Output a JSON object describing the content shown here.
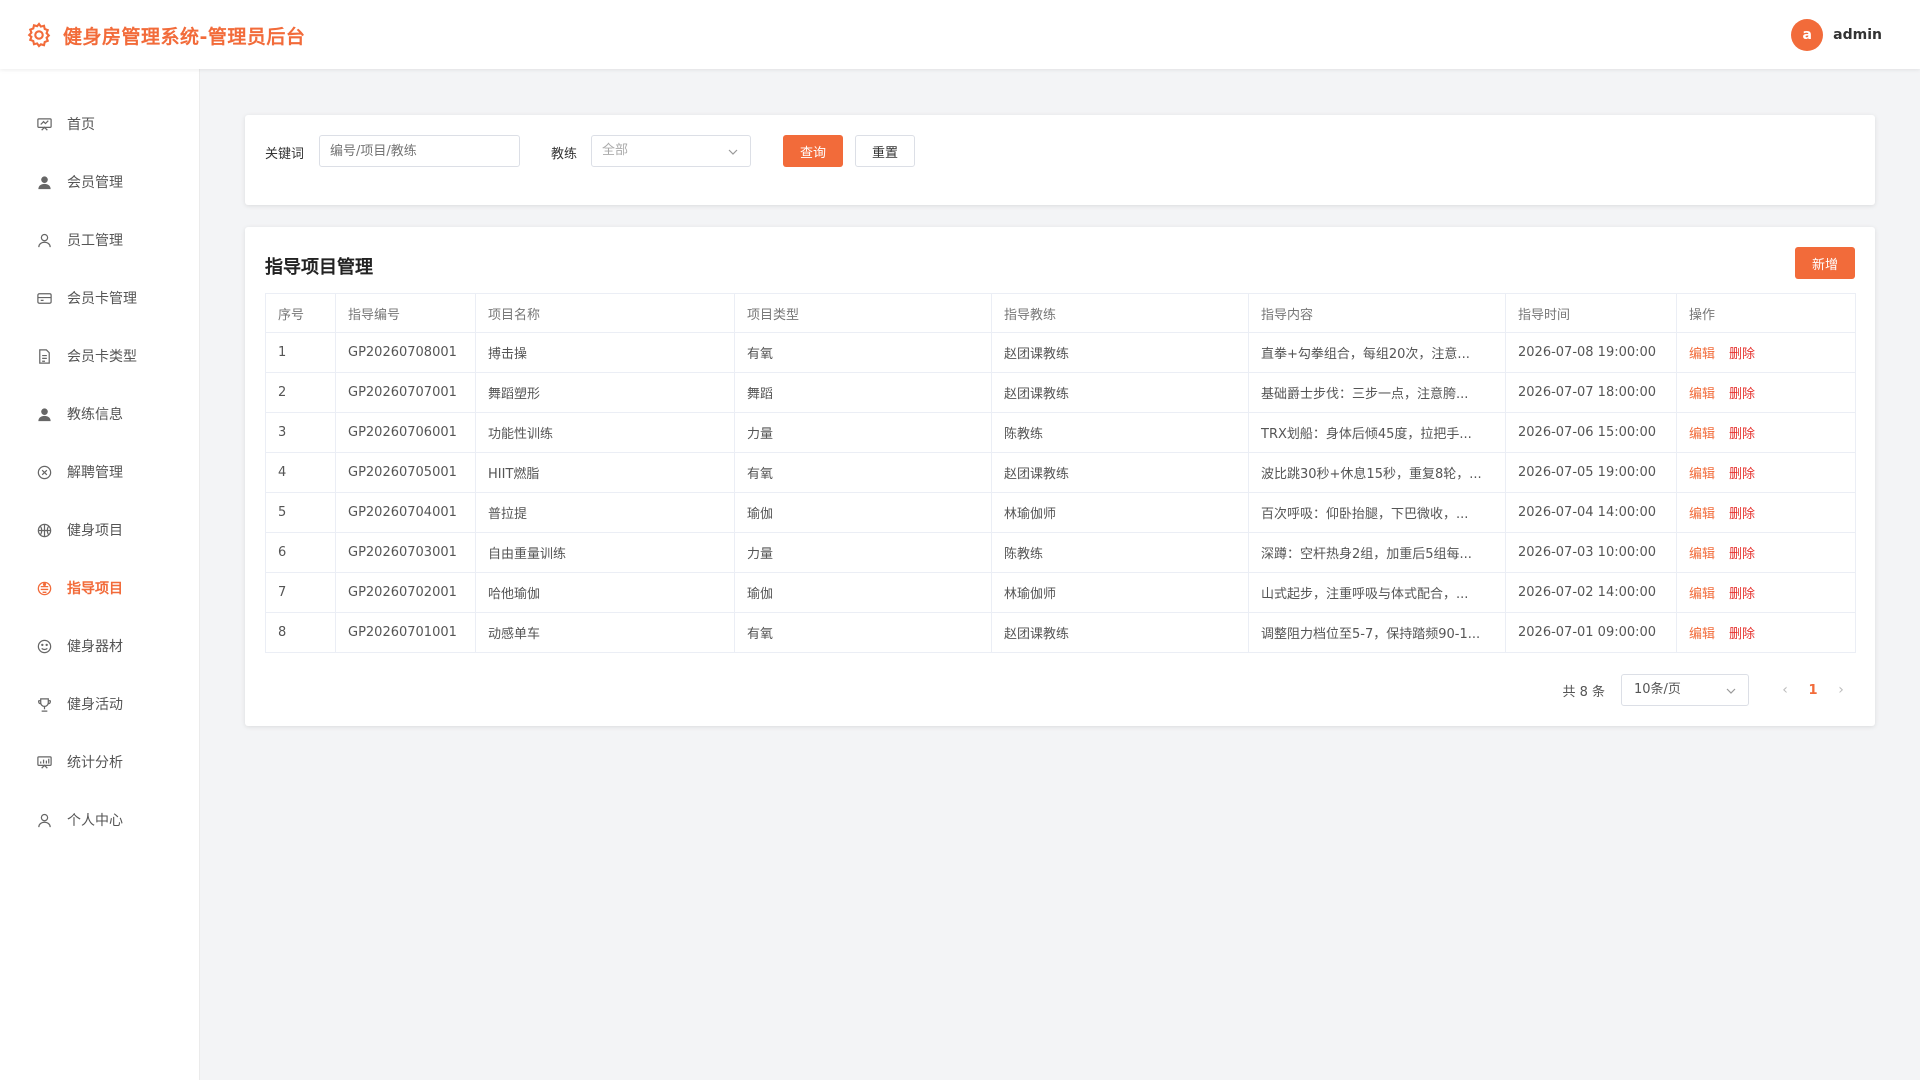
{
  "header": {
    "app_title": "健身房管理系统-管理员后台",
    "avatar_letter": "a",
    "username": "admin"
  },
  "colors": {
    "accent": "#f26b3a",
    "danger": "#e6322e"
  },
  "sidebar": {
    "items": [
      {
        "label": "首页",
        "icon": "dashboard-icon"
      },
      {
        "label": "会员管理",
        "icon": "user-solid-icon"
      },
      {
        "label": "员工管理",
        "icon": "user-outline-icon"
      },
      {
        "label": "会员卡管理",
        "icon": "card-icon"
      },
      {
        "label": "会员卡类型",
        "icon": "document-icon"
      },
      {
        "label": "教练信息",
        "icon": "user-solid-icon"
      },
      {
        "label": "解聘管理",
        "icon": "circle-close-icon"
      },
      {
        "label": "健身项目",
        "icon": "basketball-icon"
      },
      {
        "label": "指导项目",
        "icon": "guide-icon",
        "active": true
      },
      {
        "label": "健身器材",
        "icon": "smile-icon"
      },
      {
        "label": "健身活动",
        "icon": "trophy-icon"
      },
      {
        "label": "统计分析",
        "icon": "chart-icon"
      },
      {
        "label": "个人中心",
        "icon": "user-outline-icon"
      }
    ]
  },
  "filter": {
    "keyword_label": "关键词",
    "keyword_placeholder": "编号/项目/教练",
    "coach_label": "教练",
    "coach_value": "全部",
    "search_label": "查询",
    "reset_label": "重置"
  },
  "table": {
    "title": "指导项目管理",
    "add_label": "新增",
    "columns": [
      "序号",
      "指导编号",
      "项目名称",
      "项目类型",
      "指导教练",
      "指导内容",
      "指导时间",
      "操作"
    ],
    "edit_label": "编辑",
    "delete_label": "删除",
    "rows": [
      [
        "1",
        "GP20260708001",
        "搏击操",
        "有氧",
        "赵团课教练",
        "直拳+勾拳组合，每组20次，注意...",
        "2026-07-08 19:00:00"
      ],
      [
        "2",
        "GP20260707001",
        "舞蹈塑形",
        "舞蹈",
        "赵团课教练",
        "基础爵士步伐：三步一点，注意胯...",
        "2026-07-07 18:00:00"
      ],
      [
        "3",
        "GP20260706001",
        "功能性训练",
        "力量",
        "陈教练",
        "TRX划船：身体后倾45度，拉把手...",
        "2026-07-06 15:00:00"
      ],
      [
        "4",
        "GP20260705001",
        "HIIT燃脂",
        "有氧",
        "赵团课教练",
        "波比跳30秒+休息15秒，重复8轮，...",
        "2026-07-05 19:00:00"
      ],
      [
        "5",
        "GP20260704001",
        "普拉提",
        "瑜伽",
        "林瑜伽师",
        "百次呼吸：仰卧抬腿，下巴微收，...",
        "2026-07-04 14:00:00"
      ],
      [
        "6",
        "GP20260703001",
        "自由重量训练",
        "力量",
        "陈教练",
        "深蹲：空杆热身2组，加重后5组每...",
        "2026-07-03 10:00:00"
      ],
      [
        "7",
        "GP20260702001",
        "哈他瑜伽",
        "瑜伽",
        "林瑜伽师",
        "山式起步，注重呼吸与体式配合，...",
        "2026-07-02 14:00:00"
      ],
      [
        "8",
        "GP20260701001",
        "动感单车",
        "有氧",
        "赵团课教练",
        "调整阻力档位至5-7，保持踏频90-1...",
        "2026-07-01 09:00:00"
      ]
    ]
  },
  "pagination": {
    "total_text": "共 8 条",
    "page_size": "10条/页",
    "current_page": "1",
    "prev": "‹",
    "next": "›"
  }
}
